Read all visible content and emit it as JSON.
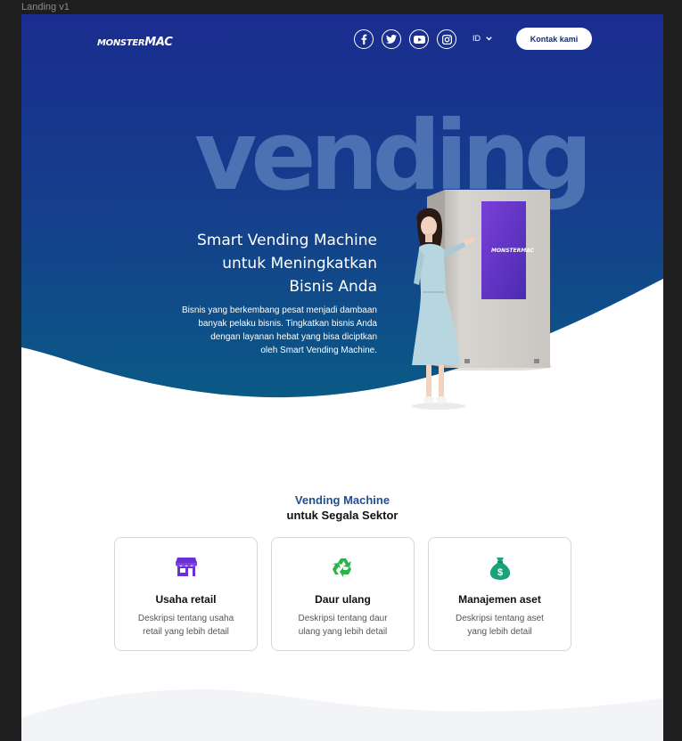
{
  "frame_label": "Landing v1",
  "header": {
    "logo_small": "MONSTER",
    "logo_big": "MAC",
    "social": [
      "facebook-icon",
      "twitter-icon",
      "youtube-icon",
      "instagram-icon"
    ],
    "lang_label": "ID",
    "cta_label": "Kontak kami"
  },
  "hero": {
    "bigword": "vending",
    "headline_line1": "Smart Vending Machine",
    "headline_line2": "untuk Meningkatkan",
    "headline_line3": "Bisnis Anda",
    "sub_line1": "Bisnis yang berkembang pesat menjadi dambaan",
    "sub_line2": "banyak pelaku bisnis. Tingkatkan bisnis Anda",
    "sub_line3": "dengan layanan hebat yang bisa diciptkan",
    "sub_line4": "oleh Smart Vending Machine.",
    "machine_logo_small": "MONSTER",
    "machine_logo_big": "MAC"
  },
  "sectors": {
    "title_line1": "Vending Machine",
    "title_line2": "untuk Segala Sektor",
    "cards": [
      {
        "icon": "store-icon",
        "title": "Usaha retail",
        "desc_line1": "Deskripsi tentang usaha",
        "desc_line2": "retail yang lebih detail"
      },
      {
        "icon": "recycle-icon",
        "title": "Daur ulang",
        "desc_line1": "Deskripsi tentang daur",
        "desc_line2": "ulang yang lebih detail"
      },
      {
        "icon": "money-bag-icon",
        "title": "Manajemen aset",
        "desc_line1": "Deskripsi tentang aset",
        "desc_line2": "yang lebih detail"
      }
    ]
  },
  "colors": {
    "hero_top": "#1a2d8f",
    "hero_bottom": "#0c5a86",
    "store_icon": "#6a2fd6",
    "recycle_icon": "#2cb34a",
    "money_icon": "#1aa37a"
  }
}
